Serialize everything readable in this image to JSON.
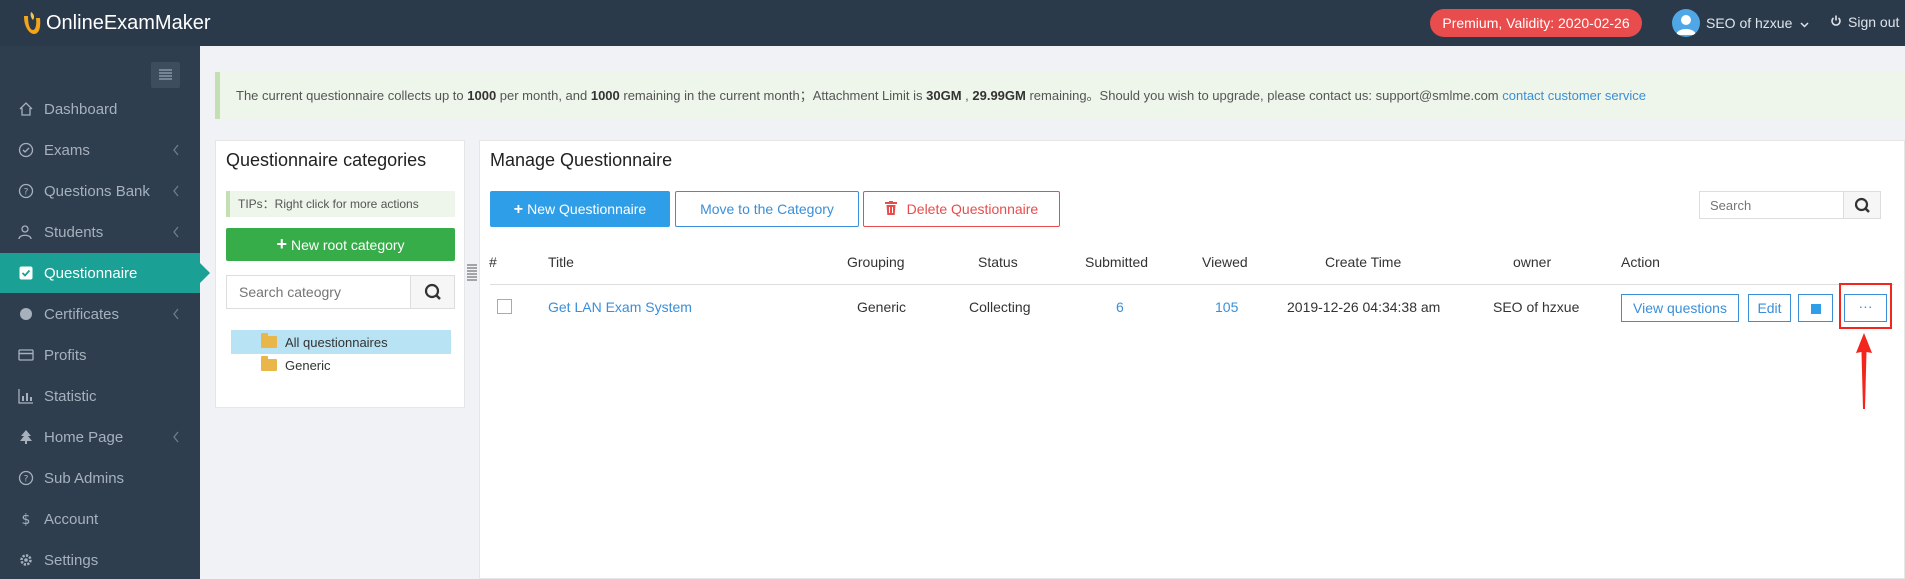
{
  "header": {
    "logo_text": "OnlineExamMaker",
    "premium_badge": "Premium, Validity: 2020-02-26",
    "user_name": "SEO of hzxue",
    "sign_out": "Sign out"
  },
  "sidebar": {
    "items": [
      {
        "label": "Dashboard",
        "icon": "home-icon",
        "has_arrow": false
      },
      {
        "label": "Exams",
        "icon": "check-circle-icon",
        "has_arrow": true
      },
      {
        "label": "Questions Bank",
        "icon": "question-circle-icon",
        "has_arrow": true
      },
      {
        "label": "Students",
        "icon": "users-icon",
        "has_arrow": true
      },
      {
        "label": "Questionnaire",
        "icon": "checkbox-icon",
        "has_arrow": false,
        "active": true
      },
      {
        "label": "Certificates",
        "icon": "certificate-icon",
        "has_arrow": true
      },
      {
        "label": "Profits",
        "icon": "card-icon",
        "has_arrow": false
      },
      {
        "label": "Statistic",
        "icon": "bar-chart-icon",
        "has_arrow": false
      },
      {
        "label": "Home Page",
        "icon": "tree-icon",
        "has_arrow": true
      },
      {
        "label": "Sub Admins",
        "icon": "question-circle-icon",
        "has_arrow": false
      },
      {
        "label": "Account",
        "icon": "dollar-icon",
        "has_arrow": false
      },
      {
        "label": "Settings",
        "icon": "gear-icon",
        "has_arrow": false
      }
    ]
  },
  "notice": {
    "text_1": "The current questionnaire collects up to ",
    "limit": "1000",
    "text_2": " per month, and ",
    "remaining": "1000",
    "text_3": " remaining in the current month；Attachment Limit is ",
    "attach_limit": "30GM",
    "text_4": " , ",
    "attach_remaining": "29.99GM",
    "text_5": " remaining。Should you wish to upgrade, please contact us: support@smlme.com ",
    "link": "contact customer service"
  },
  "categories": {
    "title": "Questionnaire categories",
    "tips": "TIPs：Right click for more actions",
    "new_root": "New root category",
    "search_placeholder": "Search cateogry",
    "tree": [
      "All questionnaires",
      "Generic"
    ]
  },
  "main": {
    "title": "Manage Questionnaire",
    "btn_new": "New Questionnaire",
    "btn_move": "Move to the Category",
    "btn_delete": "Delete Questionnaire",
    "search_placeholder": "Search",
    "columns": [
      "#",
      "Title",
      "Grouping",
      "Status",
      "Submitted",
      "Viewed",
      "Create Time",
      "owner",
      "Action"
    ],
    "rows": [
      {
        "title": "Get LAN Exam System",
        "grouping": "Generic",
        "status": "Collecting",
        "submitted": "6",
        "viewed": "105",
        "create_time": "2019-12-26 04:34:38 am",
        "owner": "SEO of hzxue",
        "actions": {
          "view": "View questions",
          "edit": "Edit",
          "more": "···"
        }
      }
    ]
  },
  "colors": {
    "topbar": "#2b3a4a",
    "sidebar": "#2f3e4e",
    "active": "#1aa094",
    "primary": "#2f9ee8",
    "danger": "#e84c4c",
    "success": "#37ad4a",
    "highlight": "#f2261c"
  }
}
